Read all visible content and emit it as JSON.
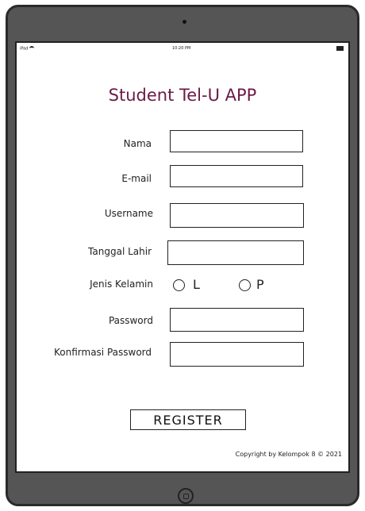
{
  "status_bar": {
    "device": "iPad",
    "time": "10:20 PM"
  },
  "app": {
    "title": "Student Tel-U APP"
  },
  "form": {
    "nama_label": "Nama",
    "email_label": "E-mail",
    "username_label": "Username",
    "tanggal_lahir_label": "Tanggal Lahir",
    "jenis_kelamin_label": "Jenis Kelamin",
    "gender_option_l": "L",
    "gender_option_p": "P",
    "password_label": "Password",
    "konfirmasi_password_label": "Konfirmasi Password",
    "nama_value": "",
    "email_value": "",
    "username_value": "",
    "tanggal_lahir_value": "",
    "password_value": "",
    "konfirmasi_password_value": ""
  },
  "register_label": "REGISTER",
  "footer": {
    "copyright": "Copyright by Kelompok 8 © 2021"
  },
  "colors": {
    "title": "#6b1a47",
    "device_bezel": "#555555",
    "device_border": "#2a2a2a"
  },
  "icons": {
    "wifi": "wifi-icon",
    "battery": "battery-icon",
    "home": "home-button-icon",
    "camera": "camera-icon"
  }
}
